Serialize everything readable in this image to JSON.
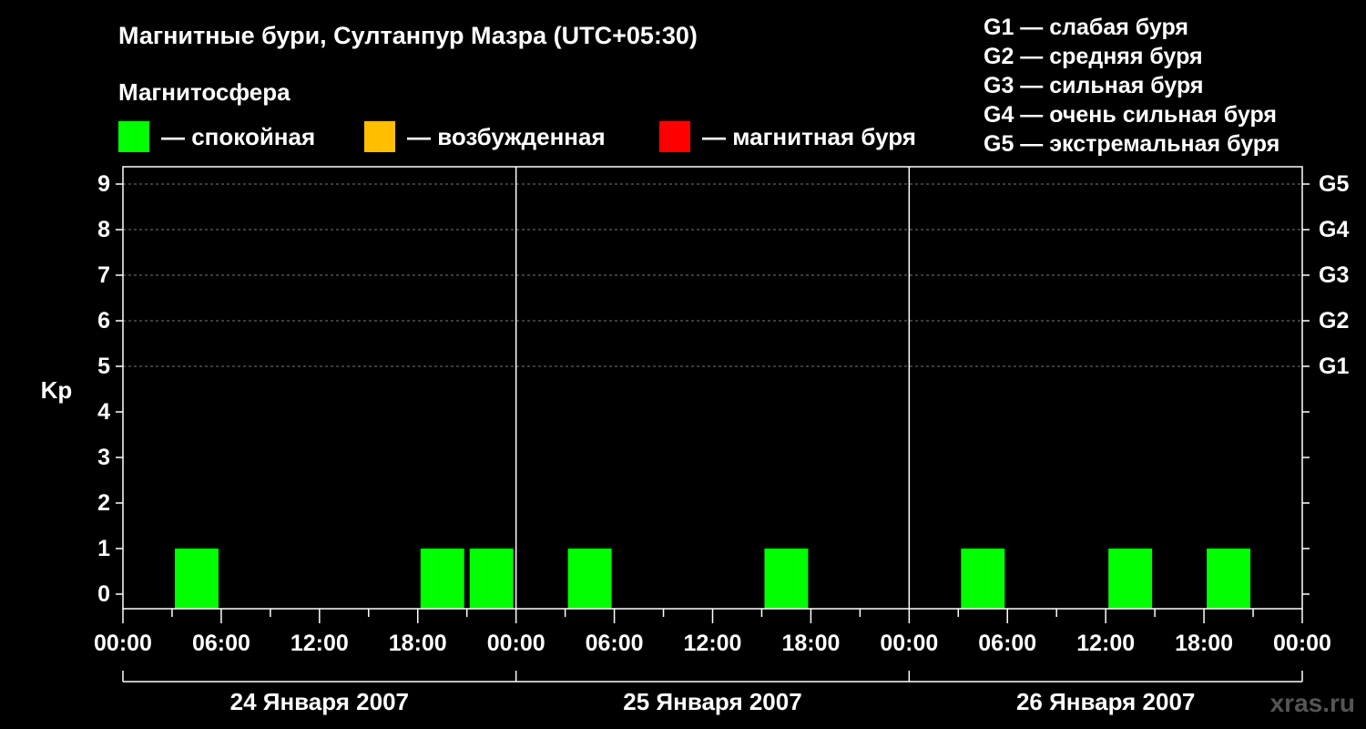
{
  "title": "Магнитные бури, Султанпур Мазра (UTC+05:30)",
  "magnetosphere_heading": "Магнитосфера",
  "legend": [
    {
      "label": "— спокойная",
      "color": "#00ff00"
    },
    {
      "label": "— возбужденная",
      "color": "#ffbf00"
    },
    {
      "label": "— магнитная буря",
      "color": "#ff0000"
    }
  ],
  "storm_levels": [
    "G1 — слабая буря",
    "G2 — средняя буря",
    "G3 — сильная буря",
    "G4 — очень сильная буря",
    "G5 — экстремальная буря"
  ],
  "watermark": "xras.ru",
  "chart_data": {
    "type": "bar",
    "ylabel": "Kp",
    "ylim": [
      0,
      9
    ],
    "y_ticks": [
      "0",
      "1",
      "2",
      "3",
      "4",
      "5",
      "6",
      "7",
      "8",
      "9"
    ],
    "right_ticks": [
      {
        "kp": 5,
        "label": "G1"
      },
      {
        "kp": 6,
        "label": "G2"
      },
      {
        "kp": 7,
        "label": "G3"
      },
      {
        "kp": 8,
        "label": "G4"
      },
      {
        "kp": 9,
        "label": "G5"
      }
    ],
    "x_tick_labels": [
      "00:00",
      "06:00",
      "12:00",
      "18:00",
      "00:00",
      "06:00",
      "12:00",
      "18:00",
      "00:00",
      "06:00",
      "12:00",
      "18:00",
      "00:00"
    ],
    "days": [
      "24 Января 2007",
      "25 Января 2007",
      "26 Января 2007"
    ],
    "grid": "dashed horizontal at Kp 5–9",
    "bars": [
      {
        "day": 0,
        "interval": "03:00–06:00",
        "kp": 1,
        "state": "спокойная"
      },
      {
        "day": 0,
        "interval": "18:00–21:00",
        "kp": 1,
        "state": "спокойная"
      },
      {
        "day": 0,
        "interval": "21:00–00:00",
        "kp": 1,
        "state": "спокойная"
      },
      {
        "day": 1,
        "interval": "03:00–06:00",
        "kp": 1,
        "state": "спокойная"
      },
      {
        "day": 1,
        "interval": "15:00–18:00",
        "kp": 1,
        "state": "спокойная"
      },
      {
        "day": 2,
        "interval": "03:00–06:00",
        "kp": 1,
        "state": "спокойная"
      },
      {
        "day": 2,
        "interval": "12:00–15:00",
        "kp": 1,
        "state": "спокойная"
      },
      {
        "day": 2,
        "interval": "18:00–21:00",
        "kp": 1,
        "state": "спокойная"
      }
    ]
  }
}
